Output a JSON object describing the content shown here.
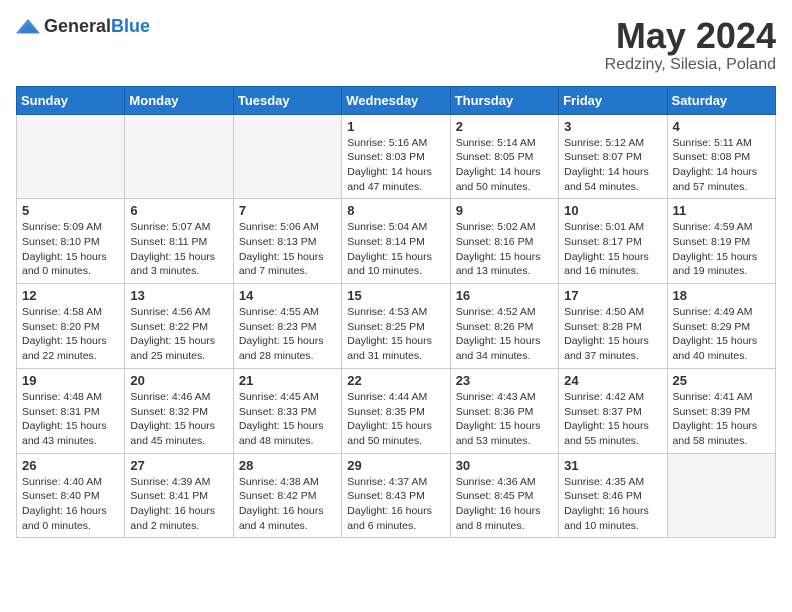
{
  "header": {
    "logo_general": "General",
    "logo_blue": "Blue",
    "month": "May 2024",
    "location": "Redziny, Silesia, Poland"
  },
  "weekdays": [
    "Sunday",
    "Monday",
    "Tuesday",
    "Wednesday",
    "Thursday",
    "Friday",
    "Saturday"
  ],
  "weeks": [
    [
      {
        "day": "",
        "info": ""
      },
      {
        "day": "",
        "info": ""
      },
      {
        "day": "",
        "info": ""
      },
      {
        "day": "1",
        "info": "Sunrise: 5:16 AM\nSunset: 8:03 PM\nDaylight: 14 hours\nand 47 minutes."
      },
      {
        "day": "2",
        "info": "Sunrise: 5:14 AM\nSunset: 8:05 PM\nDaylight: 14 hours\nand 50 minutes."
      },
      {
        "day": "3",
        "info": "Sunrise: 5:12 AM\nSunset: 8:07 PM\nDaylight: 14 hours\nand 54 minutes."
      },
      {
        "day": "4",
        "info": "Sunrise: 5:11 AM\nSunset: 8:08 PM\nDaylight: 14 hours\nand 57 minutes."
      }
    ],
    [
      {
        "day": "5",
        "info": "Sunrise: 5:09 AM\nSunset: 8:10 PM\nDaylight: 15 hours\nand 0 minutes."
      },
      {
        "day": "6",
        "info": "Sunrise: 5:07 AM\nSunset: 8:11 PM\nDaylight: 15 hours\nand 3 minutes."
      },
      {
        "day": "7",
        "info": "Sunrise: 5:06 AM\nSunset: 8:13 PM\nDaylight: 15 hours\nand 7 minutes."
      },
      {
        "day": "8",
        "info": "Sunrise: 5:04 AM\nSunset: 8:14 PM\nDaylight: 15 hours\nand 10 minutes."
      },
      {
        "day": "9",
        "info": "Sunrise: 5:02 AM\nSunset: 8:16 PM\nDaylight: 15 hours\nand 13 minutes."
      },
      {
        "day": "10",
        "info": "Sunrise: 5:01 AM\nSunset: 8:17 PM\nDaylight: 15 hours\nand 16 minutes."
      },
      {
        "day": "11",
        "info": "Sunrise: 4:59 AM\nSunset: 8:19 PM\nDaylight: 15 hours\nand 19 minutes."
      }
    ],
    [
      {
        "day": "12",
        "info": "Sunrise: 4:58 AM\nSunset: 8:20 PM\nDaylight: 15 hours\nand 22 minutes."
      },
      {
        "day": "13",
        "info": "Sunrise: 4:56 AM\nSunset: 8:22 PM\nDaylight: 15 hours\nand 25 minutes."
      },
      {
        "day": "14",
        "info": "Sunrise: 4:55 AM\nSunset: 8:23 PM\nDaylight: 15 hours\nand 28 minutes."
      },
      {
        "day": "15",
        "info": "Sunrise: 4:53 AM\nSunset: 8:25 PM\nDaylight: 15 hours\nand 31 minutes."
      },
      {
        "day": "16",
        "info": "Sunrise: 4:52 AM\nSunset: 8:26 PM\nDaylight: 15 hours\nand 34 minutes."
      },
      {
        "day": "17",
        "info": "Sunrise: 4:50 AM\nSunset: 8:28 PM\nDaylight: 15 hours\nand 37 minutes."
      },
      {
        "day": "18",
        "info": "Sunrise: 4:49 AM\nSunset: 8:29 PM\nDaylight: 15 hours\nand 40 minutes."
      }
    ],
    [
      {
        "day": "19",
        "info": "Sunrise: 4:48 AM\nSunset: 8:31 PM\nDaylight: 15 hours\nand 43 minutes."
      },
      {
        "day": "20",
        "info": "Sunrise: 4:46 AM\nSunset: 8:32 PM\nDaylight: 15 hours\nand 45 minutes."
      },
      {
        "day": "21",
        "info": "Sunrise: 4:45 AM\nSunset: 8:33 PM\nDaylight: 15 hours\nand 48 minutes."
      },
      {
        "day": "22",
        "info": "Sunrise: 4:44 AM\nSunset: 8:35 PM\nDaylight: 15 hours\nand 50 minutes."
      },
      {
        "day": "23",
        "info": "Sunrise: 4:43 AM\nSunset: 8:36 PM\nDaylight: 15 hours\nand 53 minutes."
      },
      {
        "day": "24",
        "info": "Sunrise: 4:42 AM\nSunset: 8:37 PM\nDaylight: 15 hours\nand 55 minutes."
      },
      {
        "day": "25",
        "info": "Sunrise: 4:41 AM\nSunset: 8:39 PM\nDaylight: 15 hours\nand 58 minutes."
      }
    ],
    [
      {
        "day": "26",
        "info": "Sunrise: 4:40 AM\nSunset: 8:40 PM\nDaylight: 16 hours\nand 0 minutes."
      },
      {
        "day": "27",
        "info": "Sunrise: 4:39 AM\nSunset: 8:41 PM\nDaylight: 16 hours\nand 2 minutes."
      },
      {
        "day": "28",
        "info": "Sunrise: 4:38 AM\nSunset: 8:42 PM\nDaylight: 16 hours\nand 4 minutes."
      },
      {
        "day": "29",
        "info": "Sunrise: 4:37 AM\nSunset: 8:43 PM\nDaylight: 16 hours\nand 6 minutes."
      },
      {
        "day": "30",
        "info": "Sunrise: 4:36 AM\nSunset: 8:45 PM\nDaylight: 16 hours\nand 8 minutes."
      },
      {
        "day": "31",
        "info": "Sunrise: 4:35 AM\nSunset: 8:46 PM\nDaylight: 16 hours\nand 10 minutes."
      },
      {
        "day": "",
        "info": ""
      }
    ]
  ]
}
